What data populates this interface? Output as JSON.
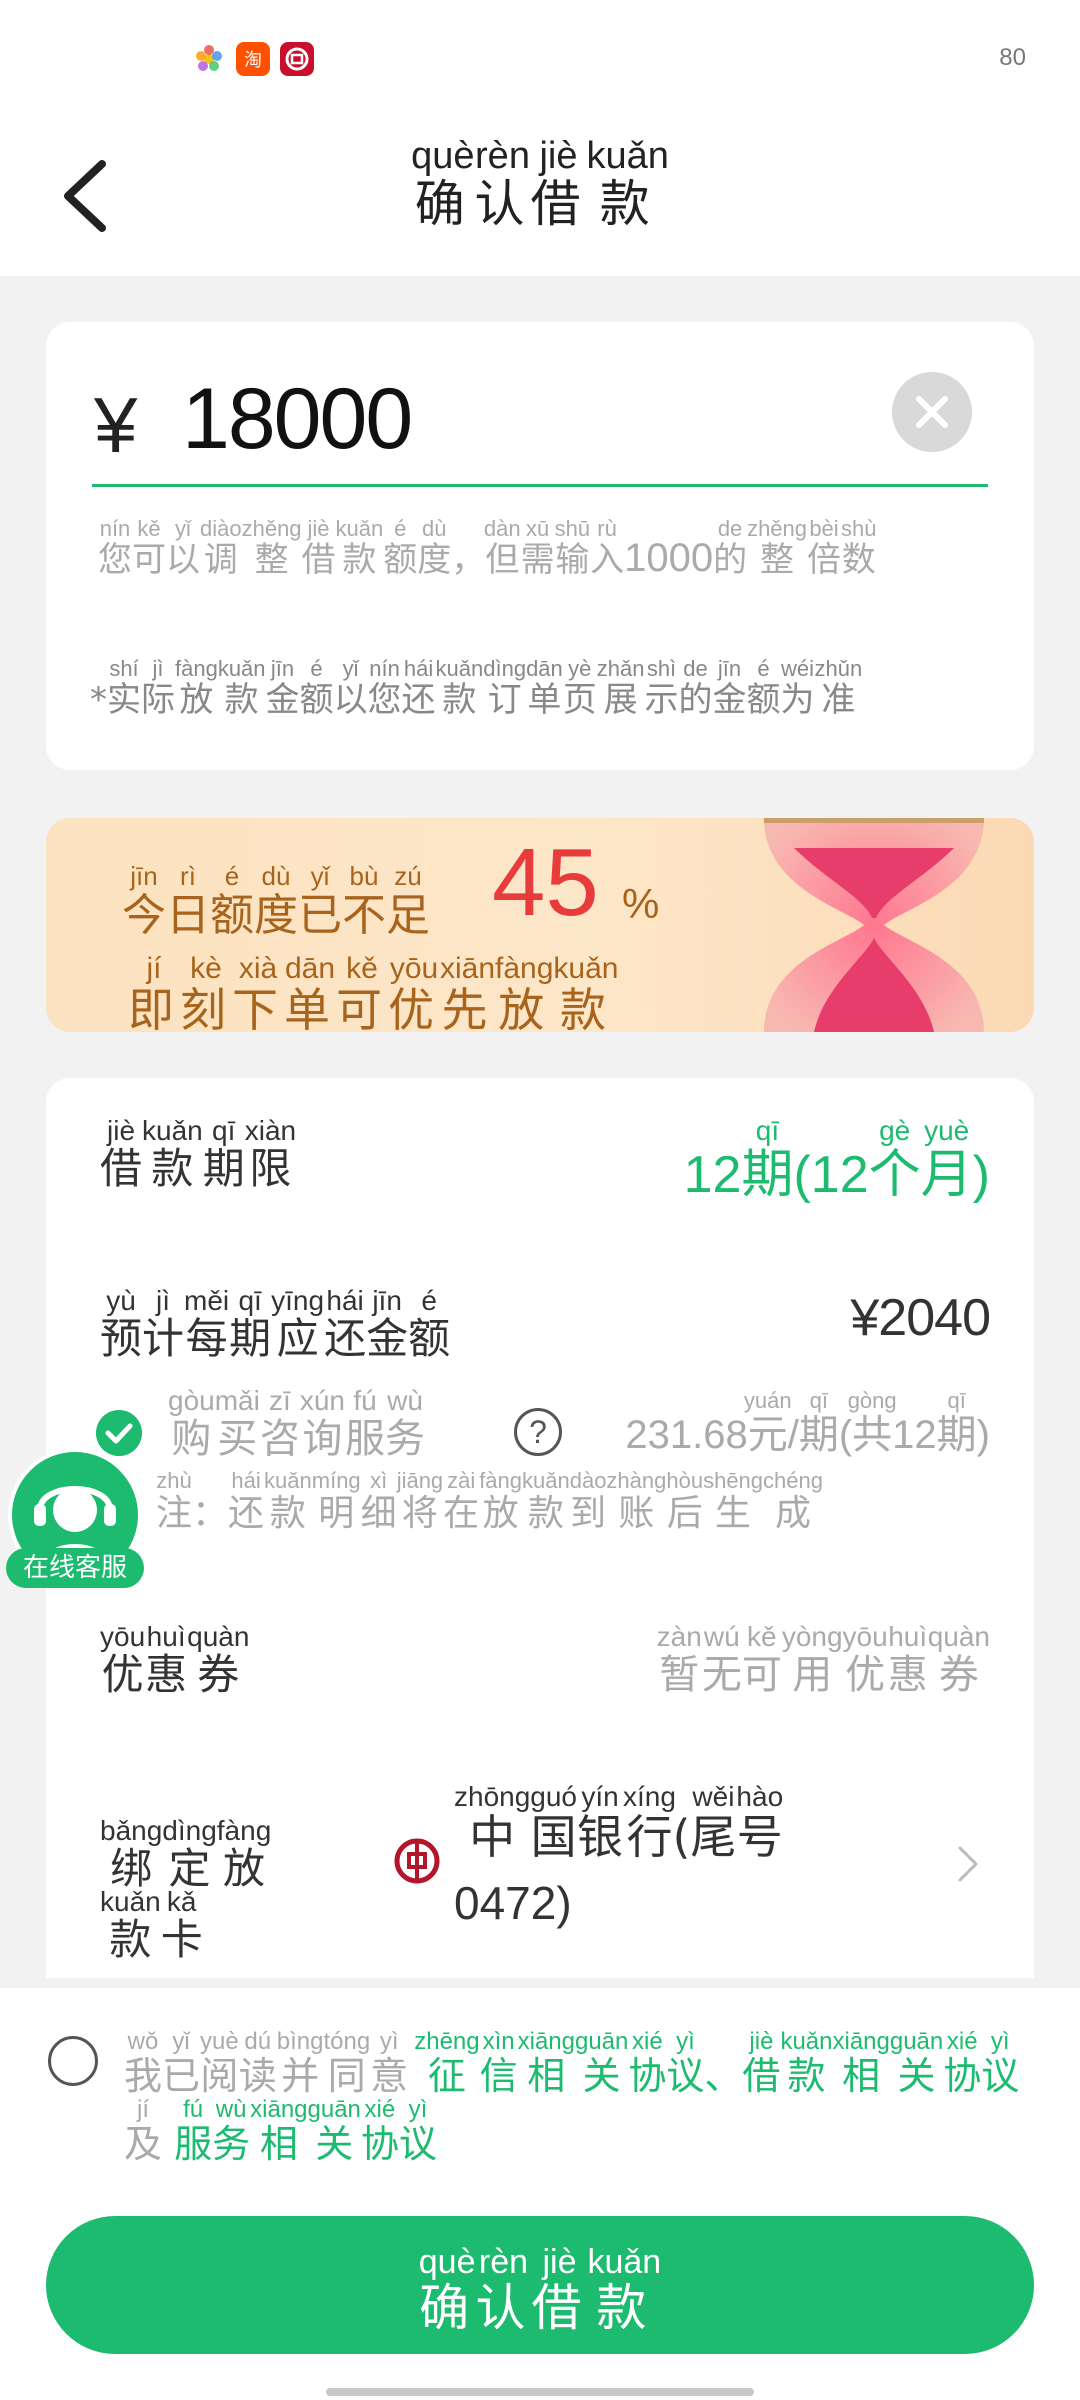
{
  "status_bar": {
    "battery": "80"
  },
  "header": {
    "back_icon": "chevron-left-icon",
    "title": [
      {
        "c": "确",
        "p": "què"
      },
      {
        "c": "认",
        "p": "rèn"
      },
      {
        "c": "借",
        "p": "jiè"
      },
      {
        "c": "款",
        "p": "kuǎn"
      }
    ]
  },
  "amount_card": {
    "currency": "¥",
    "amount": "18000",
    "clear_icon": "close-icon",
    "hint_pre": [
      {
        "c": "您",
        "p": "nín"
      },
      {
        "c": "可",
        "p": "kě"
      },
      {
        "c": "以",
        "p": "yǐ"
      },
      {
        "c": "调",
        "p": "diào"
      },
      {
        "c": "整",
        "p": "zhěng"
      },
      {
        "c": "借",
        "p": "jiè"
      },
      {
        "c": "款",
        "p": "kuǎn"
      },
      {
        "c": "额",
        "p": "é"
      },
      {
        "c": "度",
        "p": "dù"
      },
      {
        "c": "，",
        "p": ""
      },
      {
        "c": "但",
        "p": "dàn"
      },
      {
        "c": "需",
        "p": "xū"
      },
      {
        "c": "输",
        "p": "shū"
      },
      {
        "c": "入",
        "p": "rù"
      }
    ],
    "hint_number": "1000",
    "hint_post": [
      {
        "c": "的",
        "p": "de"
      },
      {
        "c": "整",
        "p": "zhěng"
      },
      {
        "c": "倍",
        "p": "bèi"
      },
      {
        "c": "数",
        "p": "shù"
      }
    ],
    "note_prefix": "*",
    "note": [
      {
        "c": "实",
        "p": "shí"
      },
      {
        "c": "际",
        "p": "jì"
      },
      {
        "c": "放",
        "p": "fàng"
      },
      {
        "c": "款",
        "p": "kuǎn"
      },
      {
        "c": "金",
        "p": "jīn"
      },
      {
        "c": "额",
        "p": "é"
      },
      {
        "c": "以",
        "p": "yǐ"
      },
      {
        "c": "您",
        "p": "nín"
      },
      {
        "c": "还",
        "p": "hái"
      },
      {
        "c": "款",
        "p": "kuǎn"
      },
      {
        "c": "订",
        "p": "dìng"
      },
      {
        "c": "单",
        "p": "dān"
      },
      {
        "c": "页",
        "p": "yè"
      },
      {
        "c": "展",
        "p": "zhǎn"
      },
      {
        "c": "示",
        "p": "shì"
      },
      {
        "c": "的",
        "p": "de"
      },
      {
        "c": "金",
        "p": "jīn"
      },
      {
        "c": "额",
        "p": "é"
      },
      {
        "c": "为",
        "p": "wéi"
      },
      {
        "c": "准",
        "p": "zhǔn"
      }
    ]
  },
  "banner": {
    "line1": [
      {
        "c": "今",
        "p": "jīn"
      },
      {
        "c": "日",
        "p": "rì"
      },
      {
        "c": "额",
        "p": "é"
      },
      {
        "c": "度",
        "p": "dù"
      },
      {
        "c": "已",
        "p": "yǐ"
      },
      {
        "c": "不",
        "p": "bù"
      },
      {
        "c": "足",
        "p": "zú"
      }
    ],
    "percent": "45",
    "percent_sign": "%",
    "line2": [
      {
        "c": "即",
        "p": "jí"
      },
      {
        "c": "刻",
        "p": "kè"
      },
      {
        "c": "下",
        "p": "xià"
      },
      {
        "c": "单",
        "p": "dān"
      },
      {
        "c": "可",
        "p": "kě"
      },
      {
        "c": "优",
        "p": "yōu"
      },
      {
        "c": "先",
        "p": "xiān"
      },
      {
        "c": "放",
        "p": "fàng"
      },
      {
        "c": "款",
        "p": "kuǎn"
      }
    ]
  },
  "details": {
    "term_label": [
      {
        "c": "借",
        "p": "jiè"
      },
      {
        "c": "款",
        "p": "kuǎn"
      },
      {
        "c": "期",
        "p": "qī"
      },
      {
        "c": "限",
        "p": "xiàn"
      }
    ],
    "term_value_num": "12",
    "term_value": [
      {
        "c": "期",
        "p": "qī"
      },
      {
        "c": "(12",
        "p": ""
      },
      {
        "c": "个",
        "p": "gè"
      },
      {
        "c": "月",
        "p": "yuè"
      },
      {
        "c": ")",
        "p": ""
      }
    ],
    "payment_label": [
      {
        "c": "预",
        "p": "yù"
      },
      {
        "c": "计",
        "p": "jì"
      },
      {
        "c": "每",
        "p": "měi"
      },
      {
        "c": "期",
        "p": "qī"
      },
      {
        "c": "应",
        "p": "yīng"
      },
      {
        "c": "还",
        "p": "hái"
      },
      {
        "c": "金",
        "p": "jīn"
      },
      {
        "c": "额",
        "p": "é"
      }
    ],
    "payment_value": "¥2040",
    "service_checked": true,
    "service_label": [
      {
        "c": "购",
        "p": "gòu"
      },
      {
        "c": "买",
        "p": "mǎi"
      },
      {
        "c": "咨",
        "p": "zī"
      },
      {
        "c": "询",
        "p": "xún"
      },
      {
        "c": "服",
        "p": "fú"
      },
      {
        "c": "务",
        "p": "wù"
      }
    ],
    "help_icon": "question-icon",
    "service_fee_amount": "231.68",
    "service_fee": [
      {
        "c": "元",
        "p": "yuán"
      },
      {
        "c": "/",
        "p": ""
      },
      {
        "c": "期",
        "p": "qī"
      },
      {
        "c": "(",
        "p": ""
      },
      {
        "c": "共",
        "p": "gòng"
      },
      {
        "c": "12",
        "p": ""
      },
      {
        "c": "期",
        "p": "qī"
      },
      {
        "c": ")",
        "p": ""
      }
    ],
    "service_note": [
      {
        "c": "注",
        "p": "zhù"
      },
      {
        "c": "：",
        "p": ""
      },
      {
        "c": "还",
        "p": "hái"
      },
      {
        "c": "款",
        "p": "kuǎn"
      },
      {
        "c": "明",
        "p": "míng"
      },
      {
        "c": "细",
        "p": "xì"
      },
      {
        "c": "将",
        "p": "jiāng"
      },
      {
        "c": "在",
        "p": "zài"
      },
      {
        "c": "放",
        "p": "fàng"
      },
      {
        "c": "款",
        "p": "kuǎn"
      },
      {
        "c": "到",
        "p": "dào"
      },
      {
        "c": "账",
        "p": "zhàng"
      },
      {
        "c": "后",
        "p": "hòu"
      },
      {
        "c": "生",
        "p": "shēng"
      },
      {
        "c": "成",
        "p": "chéng"
      }
    ],
    "coupon_label": [
      {
        "c": "优",
        "p": "yōu"
      },
      {
        "c": "惠",
        "p": "huì"
      },
      {
        "c": "券",
        "p": "quàn"
      }
    ],
    "coupon_value": [
      {
        "c": "暂",
        "p": "zàn"
      },
      {
        "c": "无",
        "p": "wú"
      },
      {
        "c": "可",
        "p": "kě"
      },
      {
        "c": "用",
        "p": "yòng"
      },
      {
        "c": "优",
        "p": "yōu"
      },
      {
        "c": "惠",
        "p": "huì"
      },
      {
        "c": "券",
        "p": "quàn"
      }
    ],
    "card_label": [
      {
        "c": "绑",
        "p": "bǎng"
      },
      {
        "c": "定",
        "p": "dìng"
      },
      {
        "c": "放",
        "p": "fàng"
      },
      {
        "c": "款",
        "p": "kuǎn"
      },
      {
        "c": "卡",
        "p": "kǎ"
      }
    ],
    "bank_icon": "bank-of-china-icon",
    "bank_name": [
      {
        "c": "中",
        "p": "zhōng"
      },
      {
        "c": "国",
        "p": "guó"
      },
      {
        "c": "银",
        "p": "yín"
      },
      {
        "c": "行",
        "p": "xíng"
      },
      {
        "c": "(",
        "p": ""
      },
      {
        "c": "尾",
        "p": "wěi"
      },
      {
        "c": "号",
        "p": "hào"
      }
    ],
    "bank_tail": "0472)",
    "chevron_icon": "chevron-right-icon"
  },
  "floating_service": {
    "label": "在线客服",
    "icon": "headset-agent-icon"
  },
  "agreement": {
    "prefix": [
      {
        "c": "我",
        "p": "wǒ"
      },
      {
        "c": "已",
        "p": "yǐ"
      },
      {
        "c": "阅",
        "p": "yuè"
      },
      {
        "c": "读",
        "p": "dú"
      },
      {
        "c": "并",
        "p": "bìng"
      },
      {
        "c": "同",
        "p": "tóng"
      },
      {
        "c": "意",
        "p": "yì"
      }
    ],
    "link1": [
      {
        "c": "征",
        "p": "zhēng"
      },
      {
        "c": "信",
        "p": "xìn"
      },
      {
        "c": "相",
        "p": "xiāng"
      },
      {
        "c": "关",
        "p": "guān"
      },
      {
        "c": "协",
        "p": "xié"
      },
      {
        "c": "议",
        "p": "yì"
      },
      {
        "c": "、",
        "p": ""
      }
    ],
    "link2": [
      {
        "c": "借",
        "p": "jiè"
      },
      {
        "c": "款",
        "p": "kuǎn"
      },
      {
        "c": "相",
        "p": "xiāng"
      },
      {
        "c": "关",
        "p": "guān"
      },
      {
        "c": "协",
        "p": "xié"
      },
      {
        "c": "议",
        "p": "yì"
      }
    ],
    "join": [
      {
        "c": "及",
        "p": "jí"
      }
    ],
    "link3": [
      {
        "c": "服",
        "p": "fú"
      },
      {
        "c": "务",
        "p": "wù"
      },
      {
        "c": "相",
        "p": "xiāng"
      },
      {
        "c": "关",
        "p": "guān"
      },
      {
        "c": "协",
        "p": "xié"
      },
      {
        "c": "议",
        "p": "yì"
      }
    ]
  },
  "confirm_button": [
    {
      "c": "确",
      "p": "què"
    },
    {
      "c": "认",
      "p": "rèn"
    },
    {
      "c": "借",
      "p": "jiè"
    },
    {
      "c": "款",
      "p": "kuǎn"
    }
  ],
  "colors": {
    "accent": "#1dbb6f",
    "warning_red": "#e83b3b",
    "banner_text": "#a8641c",
    "bank_red": "#b3152b"
  }
}
